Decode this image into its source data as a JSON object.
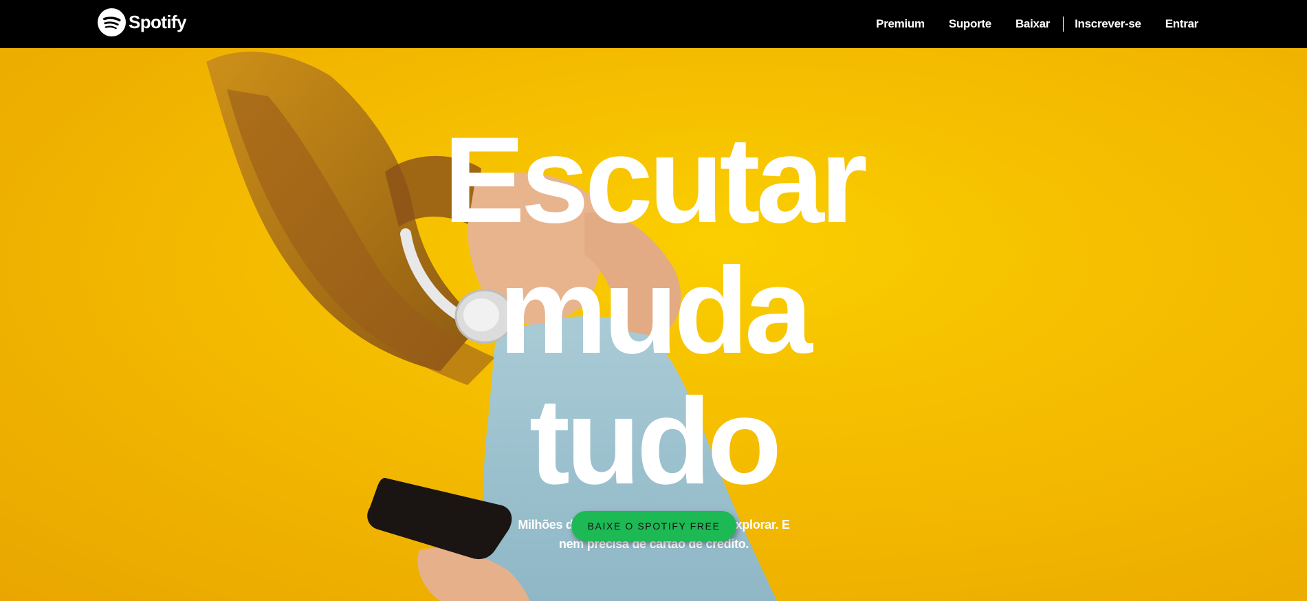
{
  "header": {
    "logo_text": "Spotify",
    "logo_icon": "spotify-logo-icon",
    "nav": [
      {
        "label": "Premium"
      },
      {
        "label": "Suporte"
      },
      {
        "label": "Baixar"
      },
      {
        "label": "Inscrever-se"
      },
      {
        "label": "Entrar"
      }
    ]
  },
  "hero": {
    "headline_lines": [
      "Escutar",
      "muda",
      "tudo"
    ],
    "subtitle": "Milhões de músicas e podcasts para explorar. E nem precisa de cartão de crédito.",
    "cta_label": "BAIXE O SPOTIFY FREE",
    "image": "woman-with-headphones-photo"
  },
  "colors": {
    "header_bg": "#000000",
    "hero_bg": "#f4bb00",
    "cta_bg": "#1db954",
    "text": "#ffffff"
  }
}
